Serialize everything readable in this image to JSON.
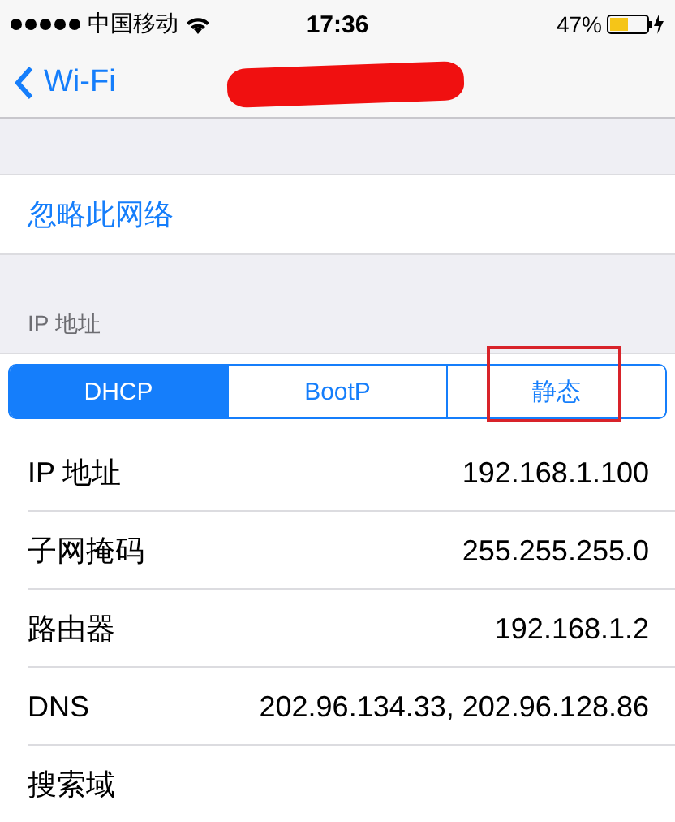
{
  "status_bar": {
    "carrier": "中国移动",
    "time": "17:36",
    "battery_percent": "47%"
  },
  "nav_bar": {
    "back_label": "Wi-Fi",
    "title_scribbled_out": true
  },
  "forget_network": "忽略此网络",
  "section_header": "IP 地址",
  "segments": [
    {
      "label": "DHCP",
      "selected": true,
      "framed": false
    },
    {
      "label": "BootP",
      "selected": false,
      "framed": false
    },
    {
      "label": "静态",
      "selected": false,
      "framed": true
    }
  ],
  "rows": [
    {
      "label": "IP 地址",
      "value": "192.168.1.100"
    },
    {
      "label": "子网掩码",
      "value": "255.255.255.0"
    },
    {
      "label": "路由器",
      "value": "192.168.1.2"
    },
    {
      "label": "DNS",
      "value": "202.96.134.33, 202.96.128.86"
    },
    {
      "label": "搜索域"
    }
  ]
}
